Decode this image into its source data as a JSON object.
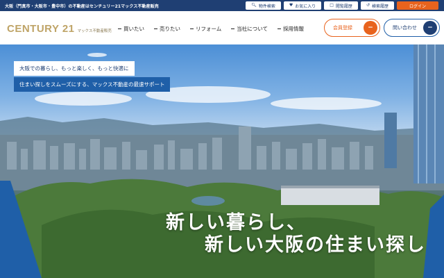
{
  "topbar": {
    "tagline": "大阪（門真市・大阪市・豊中市）の不動産はセンチュリー21マックス不動産販売",
    "utilities": [
      {
        "label": "物件検索",
        "icon": "search-icon"
      },
      {
        "label": "お気に入り",
        "icon": "heart-icon"
      },
      {
        "label": "閲覧履歴",
        "icon": "document-icon"
      },
      {
        "label": "検索履歴",
        "icon": "history-icon"
      },
      {
        "label": "ログイン"
      }
    ]
  },
  "header": {
    "logo_brand": "CENTURY 21",
    "logo_sub": "マックス不動産販売",
    "nav": [
      "買いたい",
      "売りたい",
      "リフォーム",
      "当社について",
      "採用情報"
    ],
    "member_label": "会員登録",
    "contact_label": "問い合わせ"
  },
  "hero": {
    "badge1": "大阪での暮らし、もっと楽しく、もっと快適に",
    "badge2": "住まい探しをスムーズにする、マックス不動産の最速サポート",
    "headline1": "新しい暮らし、",
    "headline2": "新しい大阪の住まい探し"
  },
  "colors": {
    "navy": "#1f3f73",
    "accent_orange": "#e8631d",
    "gold": "#bfa467",
    "blue": "#1f5fa8"
  }
}
